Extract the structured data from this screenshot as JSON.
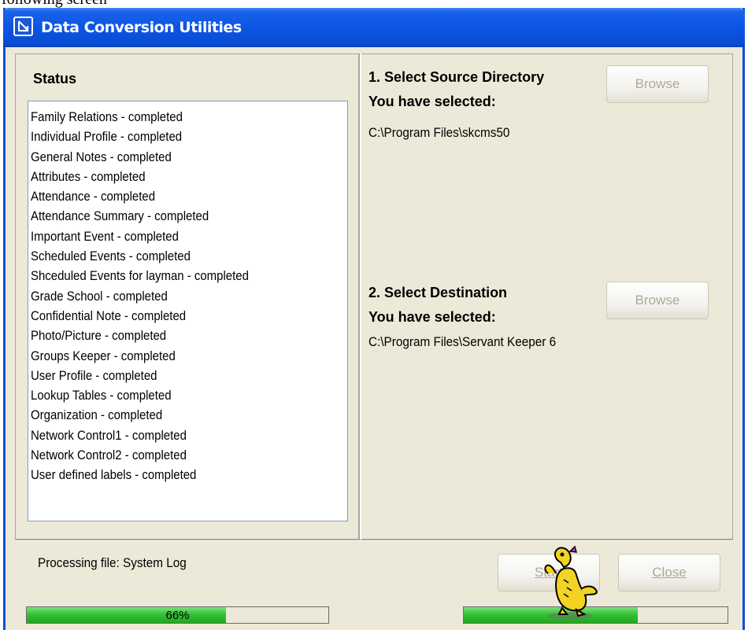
{
  "caption_fragment": "following screen",
  "window": {
    "title": "Data Conversion Utilities"
  },
  "status": {
    "heading": "Status",
    "items": [
      "Family Relations - completed",
      "Individual Profile - completed",
      "General Notes - completed",
      "Attributes - completed",
      "Attendance - completed",
      "Attendance Summary - completed",
      "Important Event - completed",
      "Scheduled Events - completed",
      "Shceduled Events for layman - completed",
      "Grade School - completed",
      "Confidential Note - completed",
      "Photo/Picture - completed",
      "Groups Keeper - completed",
      "User Profile - completed",
      "Lookup Tables - completed",
      "Organization - completed",
      "Network Control1 - completed",
      "Network Control2 - completed",
      "User defined labels - completed"
    ]
  },
  "source": {
    "title": "1.  Select Source Directory",
    "selected_label": "You have selected:",
    "path": "C:\\Program Files\\skcms50",
    "browse_label": "Browse"
  },
  "destination": {
    "title": "2.  Select Destination",
    "selected_label": "You have selected:",
    "path": "C:\\Program Files\\Servant Keeper 6",
    "browse_label": "Browse"
  },
  "footer": {
    "processing_text": "Processing file: System Log",
    "start_label": "Start",
    "close_label": "Close",
    "progress_main": {
      "percent": 66,
      "label": "66%"
    },
    "progress_secondary": {
      "percent": 66
    }
  },
  "colors": {
    "title_bar": "#0c55e4",
    "progress_fill": "#35c235",
    "window_bg": "#ece9d8"
  },
  "icons": {
    "title": "arrow-down-right-icon",
    "mascot": "dragon-assistant-icon"
  }
}
